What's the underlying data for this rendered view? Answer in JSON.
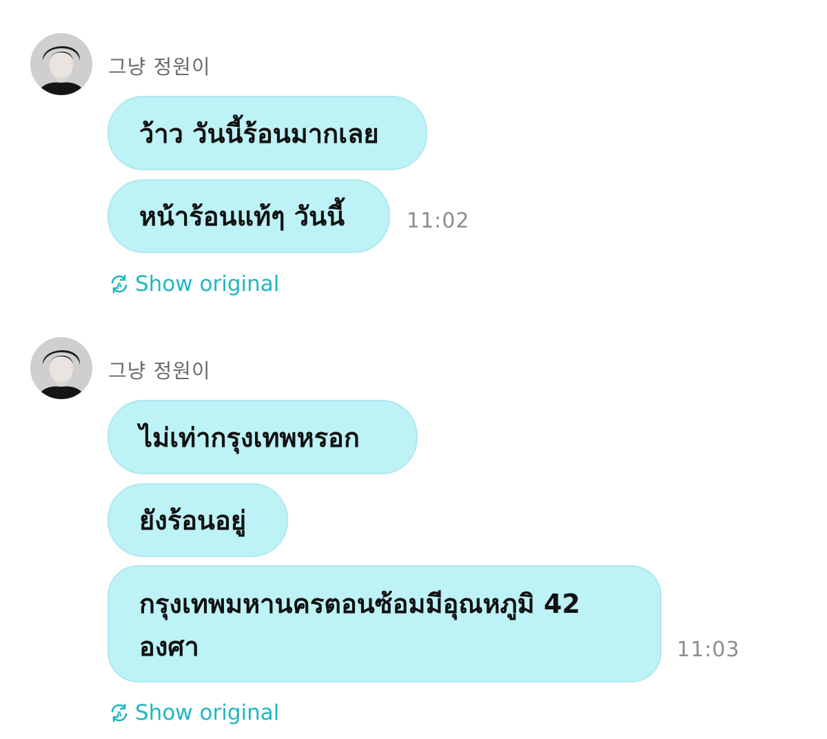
{
  "messages": [
    {
      "sender": "그냥 정원이",
      "avatar_icon": "profile-photo",
      "bubbles": [
        "ว้าว วันนี้ร้อนมากเลย",
        "หน้าร้อนแท้ๆ วันนี้"
      ],
      "time": "11:02",
      "show_original_label": "Show original"
    },
    {
      "sender": "그냥 정원이",
      "avatar_icon": "profile-photo",
      "bubbles": [
        "ไม่เท่ากรุงเทพหรอก",
        "ยังร้อนอยู่",
        "กรุงเทพมหานครตอนซ้อมมีอุณหภูมิ 42 องศา"
      ],
      "time": "11:03",
      "show_original_label": "Show original"
    }
  ],
  "colors": {
    "bubble_bg": "#bdf2f6",
    "bubble_border": "#aee8ef",
    "accent": "#1fb6c1",
    "sender_text": "#6b6b6b",
    "time_text": "#8d8d8d"
  },
  "icons": {
    "show_original": "translate-refresh-icon"
  }
}
